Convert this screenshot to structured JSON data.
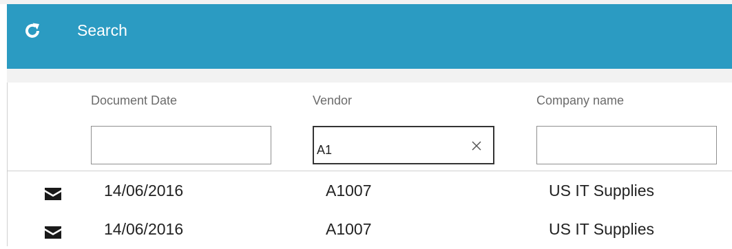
{
  "header": {
    "refresh_icon": "refresh-icon",
    "title": "Search"
  },
  "columns": {
    "document_date": "Document Date",
    "vendor": "Vendor",
    "company_name": "Company name"
  },
  "filters": {
    "document_date": "",
    "vendor": "A1",
    "company_name": ""
  },
  "rows": [
    {
      "icon": "envelope-icon",
      "document_date": "14/06/2016",
      "vendor": "A1007",
      "company_name": "US IT Supplies"
    },
    {
      "icon": "envelope-icon",
      "document_date": "14/06/2016",
      "vendor": "A1007",
      "company_name": "US IT Supplies"
    }
  ],
  "colors": {
    "header_bg": "#2b9bc2",
    "text": "#222222",
    "muted": "#6b6b6b"
  }
}
